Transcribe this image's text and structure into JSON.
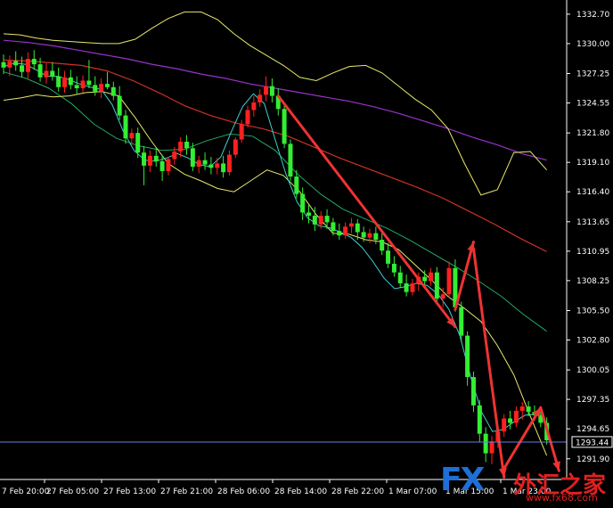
{
  "chart_data": {
    "type": "candlestick",
    "y_range": [
      1290.0,
      1334.0
    ],
    "y_ticks": [
      "1332.70",
      "1330.00",
      "1327.25",
      "1324.55",
      "1321.80",
      "1319.10",
      "1316.40",
      "1313.65",
      "1310.95",
      "1308.25",
      "1305.50",
      "1302.80",
      "1300.05",
      "1297.35",
      "1294.65",
      "1291.90"
    ],
    "x_ticks": [
      "7 Feb 20:00",
      "27 Feb 05:00",
      "27 Feb 13:00",
      "27 Feb 21:00",
      "28 Feb 06:00",
      "28 Feb 14:00",
      "28 Feb 22:00",
      "1 Mar 07:00",
      "1 Mar 15:00",
      "1 Mar 23:00"
    ],
    "current_price": 1293.44,
    "current_price_label": "1293.44",
    "colors": {
      "background": "#000000",
      "bull": "#ff2020",
      "bear": "#33ee33",
      "bollinger": "#e8e86a",
      "ma_fast": "#40d0d0",
      "ma_green": "#22aa66",
      "ma_red": "#cc3322",
      "ma_purple": "#9933cc",
      "arrow": "#ee3333",
      "price_line": "#6a7bd8",
      "axis": "#ffffff"
    },
    "candles": [
      [
        1328.3,
        1329.0,
        1327.2,
        1327.8
      ],
      [
        1327.8,
        1328.9,
        1327.0,
        1328.4
      ],
      [
        1328.4,
        1329.3,
        1327.5,
        1328.0
      ],
      [
        1328.0,
        1328.8,
        1326.9,
        1327.4
      ],
      [
        1327.4,
        1329.2,
        1326.8,
        1328.6
      ],
      [
        1328.6,
        1329.4,
        1327.6,
        1328.1
      ],
      [
        1328.1,
        1328.7,
        1326.5,
        1326.9
      ],
      [
        1326.9,
        1328.2,
        1326.3,
        1327.5
      ],
      [
        1327.5,
        1328.3,
        1326.6,
        1327.0
      ],
      [
        1327.0,
        1327.8,
        1325.6,
        1326.0
      ],
      [
        1326.0,
        1327.5,
        1325.5,
        1326.9
      ],
      [
        1326.9,
        1327.6,
        1325.8,
        1326.2
      ],
      [
        1326.2,
        1327.0,
        1325.4,
        1325.9
      ],
      [
        1325.9,
        1327.1,
        1325.5,
        1326.6
      ],
      [
        1326.6,
        1328.5,
        1325.9,
        1326.2
      ],
      [
        1326.2,
        1327.0,
        1325.2,
        1325.6
      ],
      [
        1325.6,
        1326.8,
        1325.0,
        1326.3
      ],
      [
        1326.3,
        1327.4,
        1325.8,
        1326.0
      ],
      [
        1326.0,
        1326.5,
        1324.8,
        1325.2
      ],
      [
        1325.2,
        1326.1,
        1323.0,
        1323.4
      ],
      [
        1323.4,
        1323.9,
        1320.8,
        1321.3
      ],
      [
        1321.3,
        1322.2,
        1320.6,
        1321.8
      ],
      [
        1321.8,
        1322.3,
        1319.5,
        1320.0
      ],
      [
        1320.0,
        1320.6,
        1317.0,
        1318.8
      ],
      [
        1318.8,
        1320.2,
        1318.2,
        1319.7
      ],
      [
        1319.7,
        1320.4,
        1318.7,
        1319.2
      ],
      [
        1319.2,
        1319.8,
        1317.4,
        1318.3
      ],
      [
        1318.3,
        1319.6,
        1317.9,
        1319.4
      ],
      [
        1319.4,
        1320.5,
        1318.9,
        1320.1
      ],
      [
        1320.1,
        1321.4,
        1319.6,
        1321.0
      ],
      [
        1321.0,
        1321.6,
        1319.8,
        1320.4
      ],
      [
        1320.4,
        1320.9,
        1318.3,
        1318.7
      ],
      [
        1318.7,
        1319.7,
        1318.1,
        1319.3
      ],
      [
        1319.3,
        1320.0,
        1318.4,
        1318.9
      ],
      [
        1318.9,
        1319.6,
        1318.0,
        1318.6
      ],
      [
        1318.6,
        1319.5,
        1318.0,
        1319.0
      ],
      [
        1319.0,
        1319.7,
        1317.7,
        1318.2
      ],
      [
        1318.2,
        1320.2,
        1317.9,
        1319.8
      ],
      [
        1319.8,
        1321.4,
        1319.5,
        1321.2
      ],
      [
        1321.2,
        1323.0,
        1320.9,
        1322.6
      ],
      [
        1322.6,
        1324.3,
        1322.3,
        1323.9
      ],
      [
        1323.9,
        1325.2,
        1323.3,
        1324.6
      ],
      [
        1324.6,
        1325.8,
        1324.2,
        1325.3
      ],
      [
        1325.3,
        1327.0,
        1324.7,
        1326.1
      ],
      [
        1326.1,
        1326.8,
        1324.6,
        1325.2
      ],
      [
        1325.2,
        1325.9,
        1323.4,
        1324.0
      ],
      [
        1324.0,
        1324.6,
        1320.4,
        1320.8
      ],
      [
        1320.8,
        1321.2,
        1317.4,
        1317.8
      ],
      [
        1317.8,
        1318.4,
        1315.8,
        1316.2
      ],
      [
        1316.2,
        1316.8,
        1313.8,
        1314.5
      ],
      [
        1314.5,
        1315.2,
        1313.5,
        1314.2
      ],
      [
        1314.2,
        1315.0,
        1312.8,
        1313.4
      ],
      [
        1313.4,
        1314.6,
        1313.0,
        1314.2
      ],
      [
        1314.2,
        1314.8,
        1313.0,
        1313.6
      ],
      [
        1313.6,
        1314.0,
        1312.4,
        1312.8
      ],
      [
        1312.8,
        1313.5,
        1312.0,
        1312.4
      ],
      [
        1312.4,
        1313.6,
        1312.1,
        1313.2
      ],
      [
        1313.2,
        1314.0,
        1312.6,
        1313.5
      ],
      [
        1313.5,
        1313.9,
        1312.0,
        1312.7
      ],
      [
        1312.7,
        1313.2,
        1311.8,
        1312.2
      ],
      [
        1312.2,
        1313.0,
        1311.7,
        1312.6
      ],
      [
        1312.6,
        1313.2,
        1311.6,
        1312.0
      ],
      [
        1312.0,
        1312.6,
        1310.6,
        1311.0
      ],
      [
        1311.0,
        1311.7,
        1309.4,
        1309.8
      ],
      [
        1309.8,
        1310.5,
        1308.6,
        1309.0
      ],
      [
        1309.0,
        1309.6,
        1307.6,
        1308.0
      ],
      [
        1308.0,
        1308.8,
        1306.8,
        1307.2
      ],
      [
        1307.2,
        1308.4,
        1306.9,
        1308.0
      ],
      [
        1308.0,
        1309.0,
        1307.3,
        1308.6
      ],
      [
        1308.6,
        1309.2,
        1307.7,
        1308.2
      ],
      [
        1308.2,
        1309.4,
        1307.8,
        1309.0
      ],
      [
        1309.0,
        1309.5,
        1306.3,
        1306.6
      ],
      [
        1306.6,
        1307.6,
        1305.8,
        1307.0
      ],
      [
        1307.0,
        1310.0,
        1306.7,
        1309.4
      ],
      [
        1309.4,
        1310.2,
        1305.4,
        1305.8
      ],
      [
        1305.8,
        1306.3,
        1302.6,
        1303.2
      ],
      [
        1303.2,
        1303.6,
        1298.6,
        1299.4
      ],
      [
        1299.4,
        1299.9,
        1296.2,
        1296.8
      ],
      [
        1296.8,
        1297.3,
        1293.4,
        1294.2
      ],
      [
        1294.2,
        1294.8,
        1291.6,
        1292.4
      ],
      [
        1292.4,
        1294.0,
        1291.4,
        1293.5
      ],
      [
        1293.5,
        1294.9,
        1292.9,
        1294.4
      ],
      [
        1294.4,
        1296.0,
        1293.9,
        1295.6
      ],
      [
        1295.6,
        1296.3,
        1294.6,
        1295.2
      ],
      [
        1295.2,
        1296.7,
        1294.8,
        1296.3
      ],
      [
        1296.3,
        1297.1,
        1295.5,
        1296.7
      ],
      [
        1296.7,
        1297.2,
        1295.8,
        1296.2
      ],
      [
        1296.2,
        1296.8,
        1295.4,
        1295.9
      ],
      [
        1295.9,
        1296.5,
        1294.8,
        1295.2
      ],
      [
        1295.2,
        1295.7,
        1293.2,
        1293.6
      ]
    ],
    "bollinger_upper": [
      1330.9,
      1330.8,
      1330.5,
      1330.3,
      1330.2,
      1330.1,
      1330.0,
      1330.0,
      1330.4,
      1331.4,
      1332.3,
      1332.9,
      1332.9,
      1332.2,
      1330.9,
      1329.8,
      1328.9,
      1328.0,
      1326.9,
      1326.6,
      1327.3,
      1327.9,
      1328.0,
      1327.3,
      1326.1,
      1324.9,
      1323.9,
      1322.2,
      1319.0,
      1316.1,
      1316.6,
      1320.0,
      1320.1,
      1318.4
    ],
    "bollinger_lower": [
      1324.8,
      1325.0,
      1325.3,
      1325.1,
      1325.2,
      1325.5,
      1325.6,
      1325.2,
      1323.2,
      1321.0,
      1319.0,
      1318.0,
      1317.4,
      1316.7,
      1316.4,
      1317.4,
      1318.4,
      1317.9,
      1316.4,
      1314.3,
      1312.6,
      1312.5,
      1312.0,
      1311.8,
      1311.1,
      1309.7,
      1308.3,
      1306.8,
      1305.7,
      1304.5,
      1302.3,
      1299.6,
      1295.8,
      1292.2
    ],
    "ma_fast": [
      1327.9,
      1328.2,
      1328.1,
      1327.6,
      1327.0,
      1327.0,
      1326.7,
      1326.3,
      1326.0,
      1325.8,
      1324.4,
      1322.0,
      1320.2,
      1319.3,
      1319.2,
      1319.5,
      1319.9,
      1319.5,
      1318.9,
      1318.7,
      1319.6,
      1322.0,
      1324.2,
      1325.4,
      1324.5,
      1321.2,
      1318.0,
      1315.5,
      1314.0,
      1313.3,
      1313.1,
      1312.7,
      1312.2,
      1311.3,
      1310.0,
      1308.5,
      1307.5,
      1307.7,
      1308.0,
      1307.8,
      1307.0,
      1305.6,
      1303.2,
      1299.4,
      1296.2,
      1294.4,
      1294.6,
      1295.3,
      1295.9,
      1296.0,
      1295.2
    ],
    "ma_green": [
      1327.4,
      1326.8,
      1325.9,
      1324.5,
      1322.6,
      1321.3,
      1320.6,
      1320.2,
      1320.3,
      1321.1,
      1321.7,
      1321.5,
      1320.2,
      1318.0,
      1316.2,
      1314.8,
      1313.9,
      1313.0,
      1311.9,
      1310.7,
      1309.5,
      1308.2,
      1306.8,
      1305.1,
      1303.6
    ],
    "ma_red": [
      1328.5,
      1328.4,
      1328.2,
      1328.0,
      1327.5,
      1326.6,
      1325.5,
      1324.3,
      1323.4,
      1322.7,
      1322.2,
      1321.5,
      1320.5,
      1319.5,
      1318.6,
      1317.7,
      1316.8,
      1315.8,
      1314.6,
      1313.4,
      1312.1,
      1310.9
    ],
    "ma_purple": [
      1330.3,
      1330.1,
      1329.8,
      1329.4,
      1329.0,
      1328.6,
      1328.1,
      1327.7,
      1327.2,
      1326.8,
      1326.3,
      1325.9,
      1325.5,
      1325.1,
      1324.7,
      1324.2,
      1323.6,
      1322.9,
      1322.2,
      1321.4,
      1320.7,
      1319.9,
      1319.3
    ],
    "arrows": [
      {
        "from_index": 45,
        "from_price": 1325.2,
        "to_index": 74,
        "to_price": 1304.0
      },
      {
        "from_index": 74,
        "from_price": 1305.6,
        "to_index": 77,
        "to_price": 1311.8
      },
      {
        "from_index": 77,
        "from_price": 1311.2,
        "to_index": 82,
        "to_price": 1290.2
      },
      {
        "from_index": 82,
        "from_price": 1291.0,
        "to_index": 88,
        "to_price": 1296.6
      },
      {
        "from_index": 88,
        "from_price": 1296.6,
        "to_index": 91,
        "to_price": 1290.8
      }
    ]
  },
  "watermark": {
    "fx": "FX",
    "cn": "外汇之家",
    "url": "www.fx68.com"
  }
}
